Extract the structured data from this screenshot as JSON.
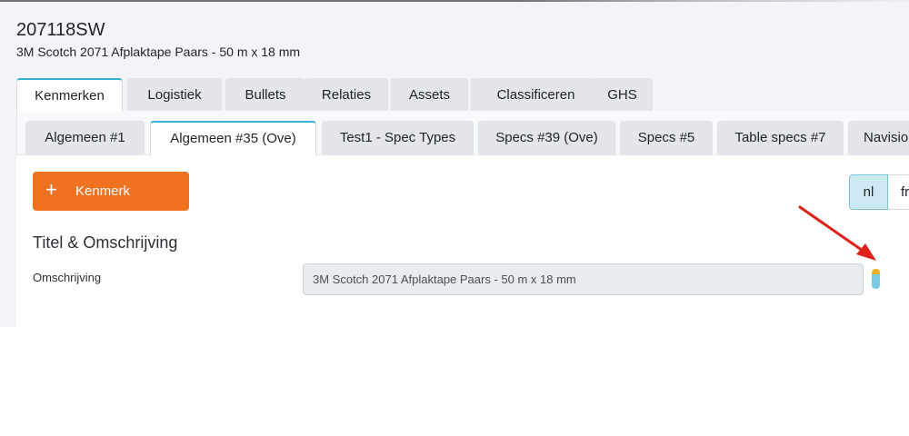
{
  "product": {
    "code": "207118SW",
    "title": "3M Scotch 2071 Afplaktape Paars - 50 m x 18 mm"
  },
  "main_tabs": [
    "Kenmerken",
    "Logistiek",
    "Bullets",
    "Relaties",
    "Assets",
    "Classificeren",
    "GHS"
  ],
  "main_tab_active": "Kenmerken",
  "sub_tabs": [
    "Algemeen #1",
    "Algemeen #35 (Ove)",
    "Test1 - Spec Types",
    "Specs #39 (Ove)",
    "Specs #5",
    "Table specs #7",
    "Navisio"
  ],
  "sub_tab_active": "Algemeen #35 (Ove)",
  "add_button": {
    "icon": "plus-icon",
    "label": "Kenmerk"
  },
  "languages": [
    "nl",
    "fr"
  ],
  "language_active": "nl",
  "section": {
    "title": "Titel & Omschrijving",
    "field_label": "Omschrijving",
    "field_value": "3M Scotch 2071 Afplaktape Paars - 50 m x 18 mm"
  },
  "colors": {
    "accent_orange": "#f07120",
    "active_tab_border": "#36b3c9",
    "indicator_yellow": "#f0b429",
    "indicator_blue": "#79cbe3",
    "annotation_arrow": "#e0201b"
  },
  "annotation": {
    "icon": "red-arrow-annotation"
  }
}
